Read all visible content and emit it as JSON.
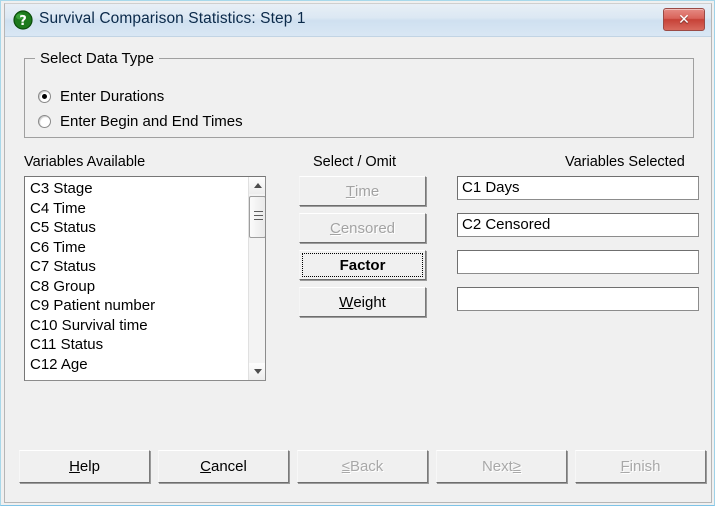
{
  "window": {
    "title": "Survival Comparison Statistics: Step 1",
    "icon": "question-mark-icon",
    "close_label": "✕",
    "accent_title_color": "#cfe0f0",
    "accent_close_color": "#c64137"
  },
  "data_type_group": {
    "legend": "Select Data Type",
    "options": [
      {
        "label_pre": "Enter Durations",
        "mnemonic": "",
        "label_post": "",
        "checked": true
      },
      {
        "label_pre": "Enter Be",
        "mnemonic": "g",
        "label_post": "in and End Times",
        "checked": false
      }
    ]
  },
  "columns": {
    "available_heading": "Variables Available",
    "select_omit_heading": "Select / Omit",
    "selected_heading": "Variables Selected"
  },
  "variables_available": [
    "C3 Stage",
    "C4 Time",
    "C5 Status",
    "C6 Time",
    "C7 Status",
    "C8 Group",
    "C9 Patient number",
    "C10 Survival time",
    "C11 Status",
    "C12 Age"
  ],
  "select_omit_buttons": [
    {
      "pre": "",
      "mnemonic": "T",
      "post": "ime",
      "enabled": false,
      "focused": false
    },
    {
      "pre": "",
      "mnemonic": "C",
      "post": "ensored",
      "enabled": false,
      "focused": false
    },
    {
      "pre": "Factor",
      "mnemonic": "",
      "post": "",
      "enabled": true,
      "focused": true
    },
    {
      "pre": "",
      "mnemonic": "W",
      "post": "eight",
      "enabled": true,
      "focused": false
    }
  ],
  "variables_selected": [
    {
      "value": "C1 Days"
    },
    {
      "value": "C2 Censored"
    },
    {
      "value": ""
    },
    {
      "value": ""
    }
  ],
  "bottom_buttons": [
    {
      "pre": "",
      "mnemonic": "H",
      "post": "elp",
      "enabled": true
    },
    {
      "pre": "",
      "mnemonic": "C",
      "post": "ancel",
      "enabled": true
    },
    {
      "pre": "",
      "mnemonic": "≤",
      "post": " Back",
      "enabled": false
    },
    {
      "pre": "Next ",
      "mnemonic": "≥",
      "post": "",
      "enabled": false
    },
    {
      "pre": "",
      "mnemonic": "F",
      "post": "inish",
      "enabled": false
    }
  ]
}
